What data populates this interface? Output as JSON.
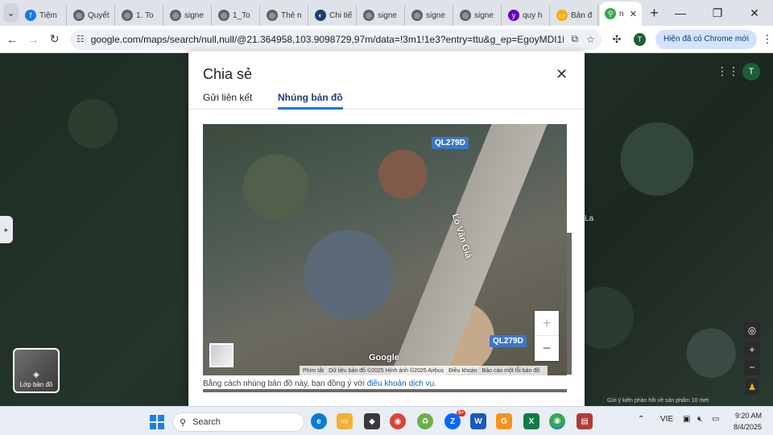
{
  "browser": {
    "tabs": [
      {
        "label": "Tiệm",
        "fav_color": "#1877f2",
        "fav_glyph": "f"
      },
      {
        "label": "Quyết",
        "fav_color": "#5f6368",
        "fav_glyph": "◎"
      },
      {
        "label": "1. To",
        "fav_color": "#5f6368",
        "fav_glyph": "◎"
      },
      {
        "label": "signe",
        "fav_color": "#5f6368",
        "fav_glyph": "◎"
      },
      {
        "label": "1_To",
        "fav_color": "#5f6368",
        "fav_glyph": "◎"
      },
      {
        "label": "Thẻ n",
        "fav_color": "#5f6368",
        "fav_glyph": "◎"
      },
      {
        "label": "Chi tiế",
        "fav_color": "#1a3f74",
        "fav_glyph": "◐"
      },
      {
        "label": "signe",
        "fav_color": "#5f6368",
        "fav_glyph": "◎"
      },
      {
        "label": "signe",
        "fav_color": "#5f6368",
        "fav_glyph": "◎"
      },
      {
        "label": "signe",
        "fav_color": "#5f6368",
        "fav_glyph": "◎"
      },
      {
        "label": "quy h",
        "fav_color": "#6001d2",
        "fav_glyph": "y"
      },
      {
        "label": "Bản đ",
        "fav_color": "#f9ab00",
        "fav_glyph": "▭"
      }
    ],
    "active_tab": {
      "label": "n",
      "fav_color": "#34a853",
      "fav_glyph": "⚲"
    },
    "new_tab_glyph": "+",
    "url": "google.com/maps/search/null,null/@21.364958,103.9098729,97m/data=!3m1!1e3?entry=ttu&g_ep=EgoyMDI1MDczMC4w...",
    "profile_initial": "T",
    "chrome_new_label": "Hiện đã có Chrome mới"
  },
  "map": {
    "layers_label": "Lớp bản đồ",
    "account_initial": "T",
    "background_label": "La",
    "footer_text": "Gửi ý kiến phản hồi về sản phẩm   10 mét"
  },
  "dialog": {
    "title": "Chia sẻ",
    "tabs": [
      {
        "label": "Gửi liên kết"
      },
      {
        "label": "Nhúng bản đồ"
      }
    ],
    "selected_tab": "Nhúng bản đồ",
    "embed": {
      "road_label_top": "QL279D",
      "road_label_bottom": "QL279D",
      "street_name": "Lò Văn Giá",
      "google_logo": "Google",
      "attribution": [
        "Phím tắt",
        "Dữ liệu bản đồ ©2025 Hình ảnh ©2025 Airbus",
        "Điều khoản",
        "Báo cáo một lỗi bản đồ"
      ]
    },
    "consent_text": "Bằng cách nhúng bản đồ này, bạn đồng ý với ",
    "consent_link": "điều khoản dịch vụ",
    "consent_end": "."
  },
  "taskbar": {
    "search_placeholder": "Search",
    "zalo_badge": "5+",
    "language": "VIE",
    "time": "9:20 AM",
    "date": "8/4/2025"
  }
}
